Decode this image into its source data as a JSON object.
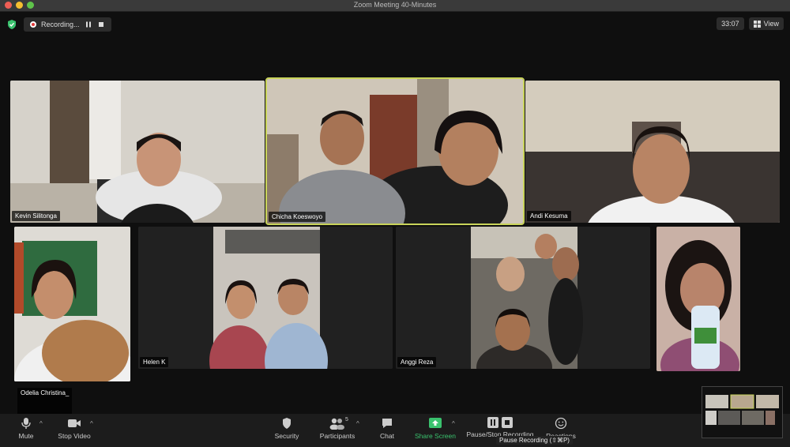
{
  "window": {
    "title": "Zoom Meeting  40-Minutes",
    "dots": [
      "#ee5e55",
      "#f5bd30",
      "#5fc34a"
    ]
  },
  "topbar": {
    "recording_label": "Recording...",
    "timer": "33:07",
    "view_label": "View"
  },
  "participants": [
    {
      "name": "Kevin Silitonga"
    },
    {
      "name": "Chicha Koeswoyo"
    },
    {
      "name": "Andi Kesuma"
    },
    {
      "name": "Odelia Christina_"
    },
    {
      "name": "Helen K"
    },
    {
      "name": "Anggi Reza"
    },
    {
      "name": ""
    }
  ],
  "toolbar": {
    "mute": "Mute",
    "stop_video": "Stop Video",
    "security": "Security",
    "participants": "Participants",
    "participants_count": "5",
    "chat": "Chat",
    "share_screen": "Share Screen",
    "pause_stop_recording": "Pause/Stop Recording",
    "reactions": "Reactions",
    "tooltip": "Pause Recording (⇧⌘P)"
  },
  "colors": {
    "accent_green": "#3ac26e",
    "active_speaker": "#c9d45a",
    "recording_red": "#e23b3b"
  }
}
